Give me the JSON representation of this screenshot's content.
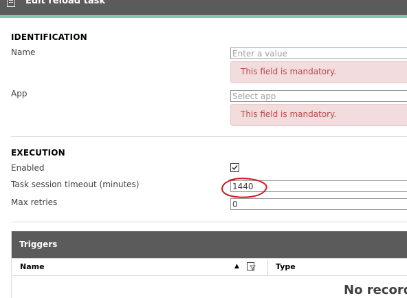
{
  "window": {
    "title": "Edit reload task",
    "icon": "document-icon"
  },
  "identification": {
    "heading": "IDENTIFICATION",
    "name_label": "Name",
    "name_placeholder": "Enter a value",
    "name_value": "",
    "name_error": "This field is mandatory.",
    "app_label": "App",
    "app_placeholder": "Select app",
    "app_value": "",
    "app_error": "This field is mandatory."
  },
  "execution": {
    "heading": "EXECUTION",
    "enabled_label": "Enabled",
    "enabled": true,
    "timeout_label": "Task session timeout (minutes)",
    "timeout_value": "1440",
    "retries_label": "Max retries",
    "retries_value": "0"
  },
  "triggers": {
    "heading": "Triggers",
    "columns": [
      "Name",
      "Type"
    ],
    "empty_message": "No records"
  },
  "colors": {
    "header_bg": "#5b5b5b",
    "accent": "#7cc8b3",
    "error_bg": "#f2dcdd",
    "error_text": "#b94a48",
    "annotation": "#d9141b"
  }
}
